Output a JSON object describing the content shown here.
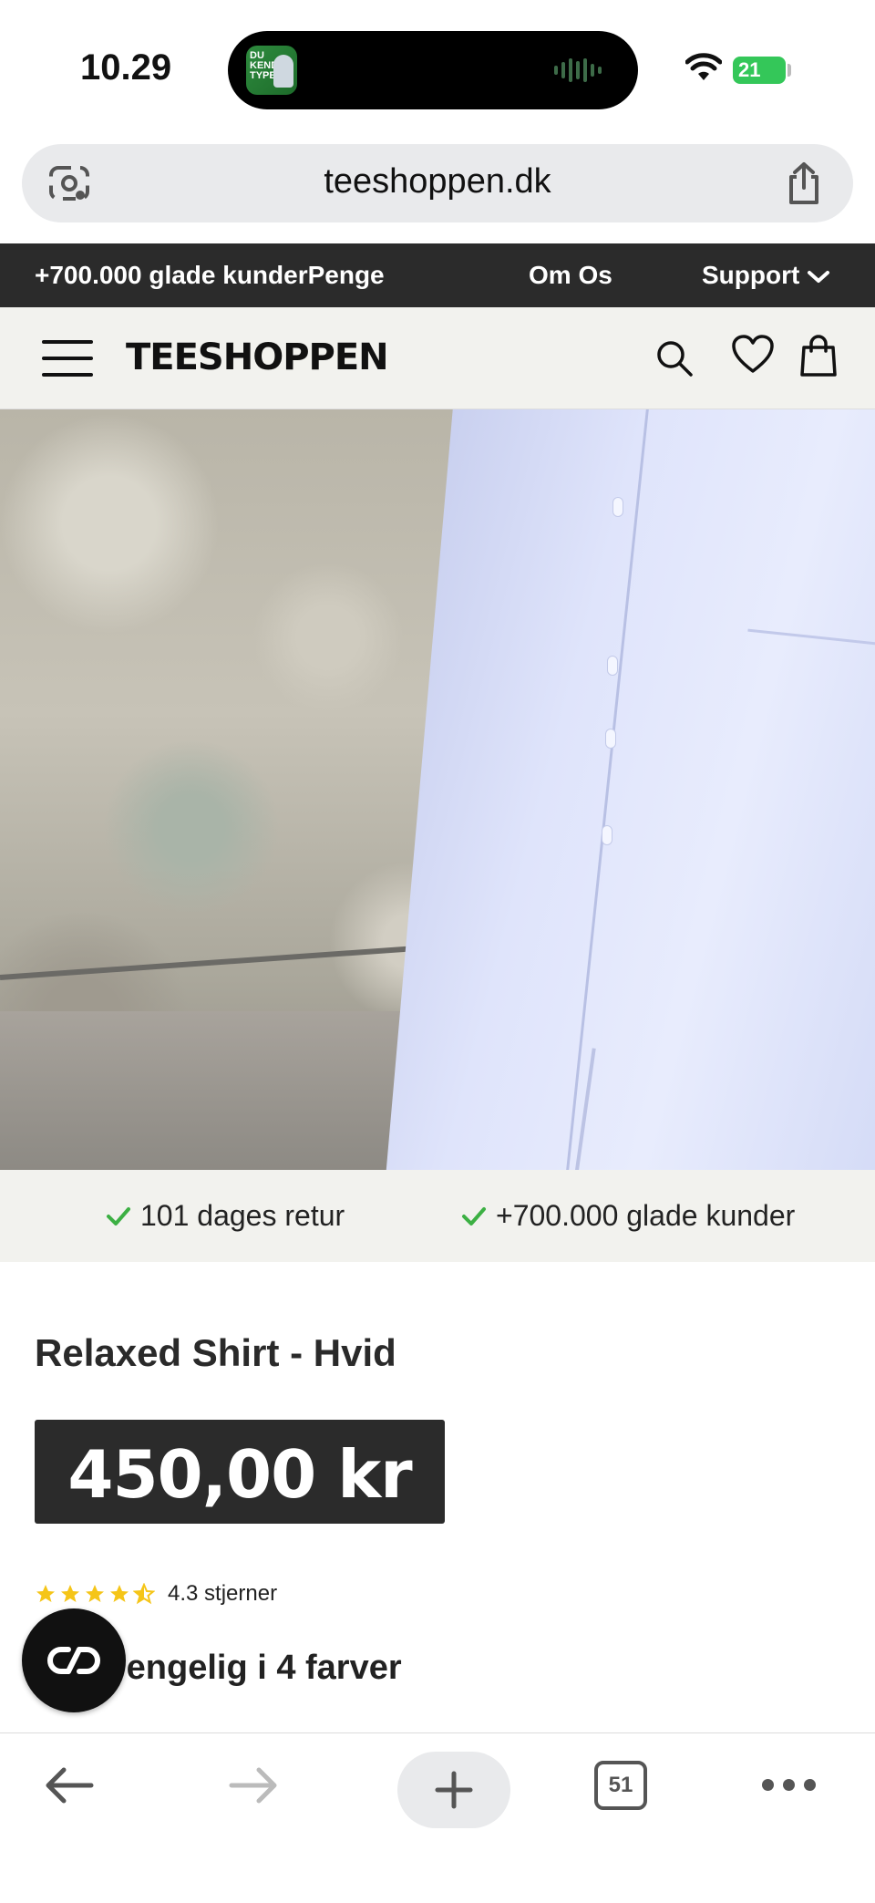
{
  "status_bar": {
    "time": "10.29",
    "live_activity_thumb_text": "DU KENDER TYPEN",
    "battery_level": "21"
  },
  "browser": {
    "url": "teeshoppen.dk",
    "tab_count": "51"
  },
  "promo_bar": {
    "items": [
      "+700.000 glade kunderPenge",
      "Om Os",
      "Support"
    ]
  },
  "header": {
    "logo": "TEESHOPPEN"
  },
  "usp_bar": {
    "items": [
      "101 dages retur",
      "+700.000 glade kunder"
    ],
    "check_color": "#3cb043"
  },
  "product": {
    "title": "Relaxed Shirt - Hvid",
    "price": "450,00 kr",
    "rating": 4.3,
    "rating_text": "4.3 stjerner",
    "colors_heading": "Tilgængelig i 4 farver",
    "colors_heading_visible": "engelig i 4 farver"
  },
  "colors": {
    "promo_bg": "#2b2b2b",
    "header_bg": "#f2f2ee",
    "star": "#f5c518",
    "battery": "#34c759"
  }
}
